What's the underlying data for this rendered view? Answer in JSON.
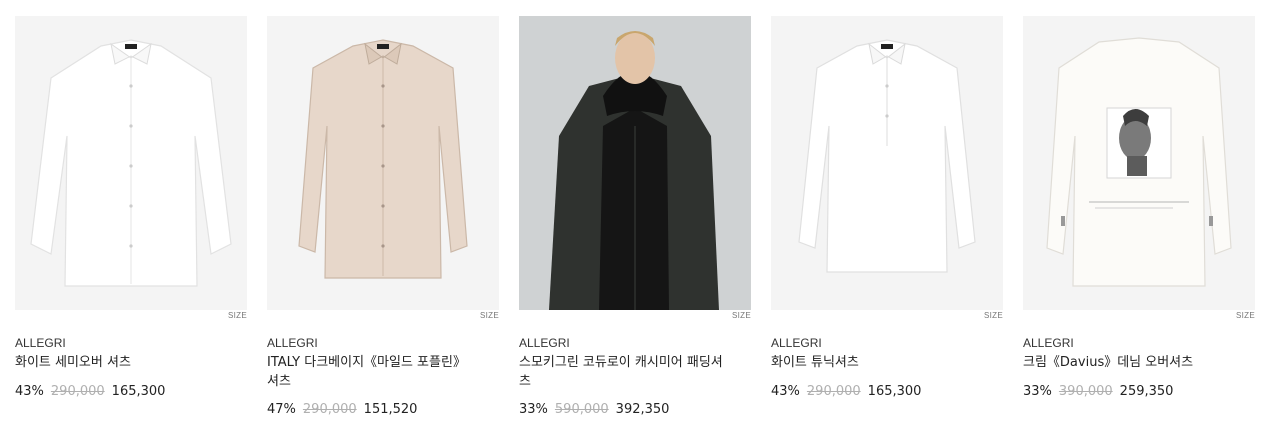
{
  "products": [
    {
      "brand": "ALLEGRI",
      "name": "화이트 세미오버 셔츠",
      "discount": "43%",
      "original_price": "290,000",
      "sale_price": "165,300",
      "size_label": "SIZE"
    },
    {
      "brand": "ALLEGRI",
      "name": "ITALY 다크베이지《마일드 포플린》셔츠",
      "discount": "47%",
      "original_price": "290,000",
      "sale_price": "151,520",
      "size_label": "SIZE"
    },
    {
      "brand": "ALLEGRI",
      "name": "스모키그린 코듀로이 캐시미어 패딩셔츠",
      "discount": "33%",
      "original_price": "590,000",
      "sale_price": "392,350",
      "size_label": "SIZE"
    },
    {
      "brand": "ALLEGRI",
      "name": "화이트 튜닉셔츠",
      "discount": "43%",
      "original_price": "290,000",
      "sale_price": "165,300",
      "size_label": "SIZE"
    },
    {
      "brand": "ALLEGRI",
      "name": "크림《Davius》데님 오버셔츠",
      "discount": "33%",
      "original_price": "390,000",
      "sale_price": "259,350",
      "size_label": "SIZE"
    }
  ]
}
